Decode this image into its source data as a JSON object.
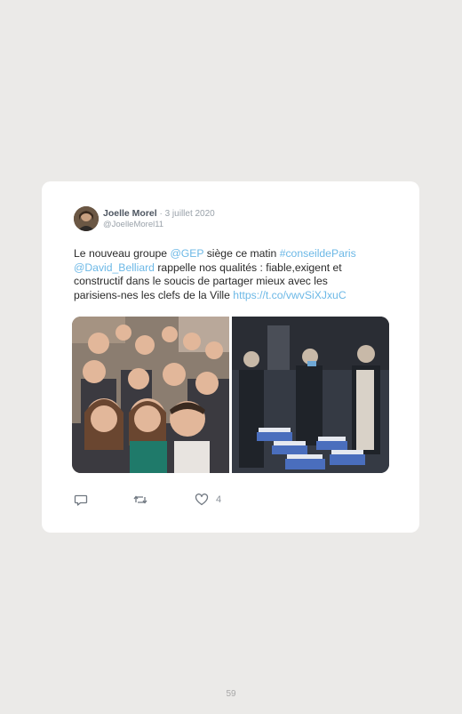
{
  "tweet": {
    "author_name": "Joelle Morel",
    "separator": " · ",
    "date": "3 juillet 2020",
    "handle": "@JoelleMorel11",
    "text": {
      "l1_a": "Le nouveau groupe ",
      "l1_mention": "@GEP",
      "l1_b": " siège ce matin ",
      "l1_hashtag": "#conseildeParis",
      "l2_mention": "@David_Belliard",
      "l2_b": " rappelle nos qualités : fiable,exigent et",
      "l3": "constructif dans le soucis de partager mieux avec les",
      "l4_a": "parisiens-nes les clefs de la Ville ",
      "l4_link": "https://t.co/vwvSiXJxuC"
    },
    "like_count": "4"
  },
  "icons": {
    "reply": "comment-icon",
    "retweet": "retweet-icon",
    "like": "heart-icon"
  },
  "colors": {
    "link": "#6cb8e6",
    "page_background": "#ebeae8",
    "card_background": "#ffffff"
  },
  "page_number": "59"
}
